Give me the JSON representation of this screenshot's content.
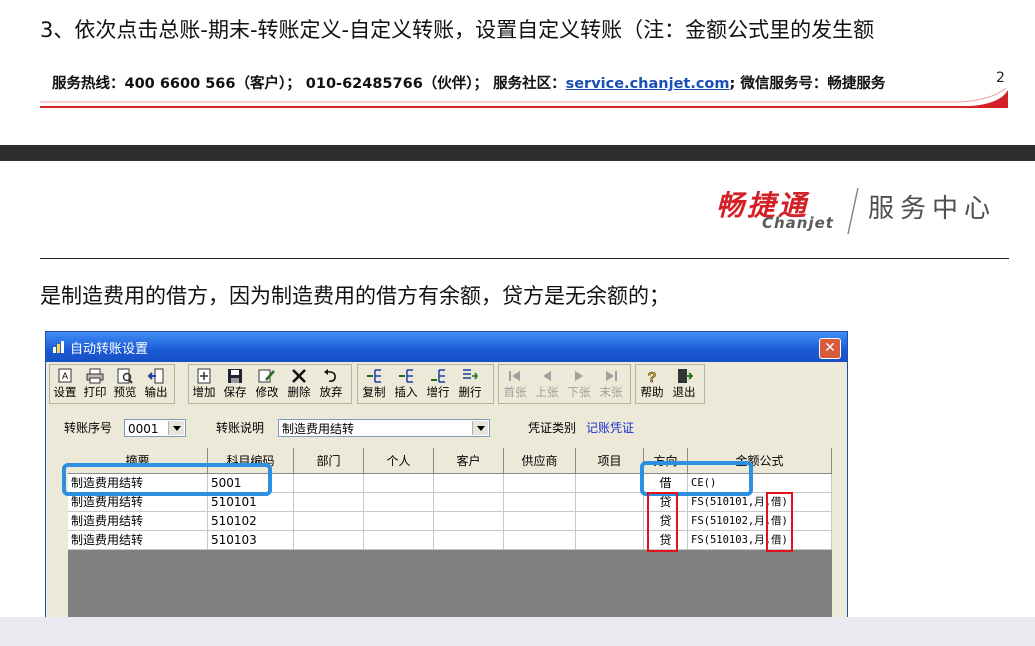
{
  "step_text": "3、依次点击总账-期末-转账定义-自定义转账，设置自定义转账（注：金额公式里的发生额",
  "hotline": {
    "prefix": "服务热线：400 6600 566（客户）；  010-62485766（伙伴）；      服务社区：",
    "link": "service.chanjet.com",
    "suffix": ";     微信服务号：畅捷服务"
  },
  "page_number": "2",
  "logo": {
    "cn": "畅捷通",
    "en": "Chanjet",
    "service": "服务中心"
  },
  "description": "是制造费用的借方，因为制造费用的借方有余额，贷方是无余额的；",
  "window": {
    "title": "自动转账设置",
    "close_glyph": "✕",
    "toolbar": {
      "g1": [
        "设置",
        "打印",
        "预览",
        "输出"
      ],
      "g2": [
        "增加",
        "保存",
        "修改",
        "删除",
        "放弃"
      ],
      "g3": [
        "复制",
        "插入",
        "增行",
        "删行"
      ],
      "g4": [
        "首张",
        "上张",
        "下张",
        "末张"
      ],
      "g5": [
        "帮助",
        "退出"
      ]
    },
    "form": {
      "seq_label": "转账序号",
      "seq_value": "0001",
      "desc_label": "转账说明",
      "desc_value": "制造费用结转",
      "vtype_label": "凭证类别",
      "vtype_value": "记账凭证"
    },
    "columns": [
      "摘要",
      "科目编码",
      "部门",
      "个人",
      "客户",
      "供应商",
      "项目",
      "方向",
      "金额公式"
    ],
    "rows": [
      {
        "summary": "制造费用结转",
        "code": "5001",
        "direction": "借",
        "formula": "CE()"
      },
      {
        "summary": "制造费用结转",
        "code": "510101",
        "direction": "贷",
        "formula": "FS(510101,月,借)"
      },
      {
        "summary": "制造费用结转",
        "code": "510102",
        "direction": "贷",
        "formula": "FS(510102,月,借)"
      },
      {
        "summary": "制造费用结转",
        "code": "510103",
        "direction": "贷",
        "formula": "FS(510103,月,借)"
      }
    ]
  },
  "colors": {
    "accent_red": "#d42027",
    "highlight_blue": "#2d8fe0",
    "title_blue": "#1b5ad6"
  }
}
